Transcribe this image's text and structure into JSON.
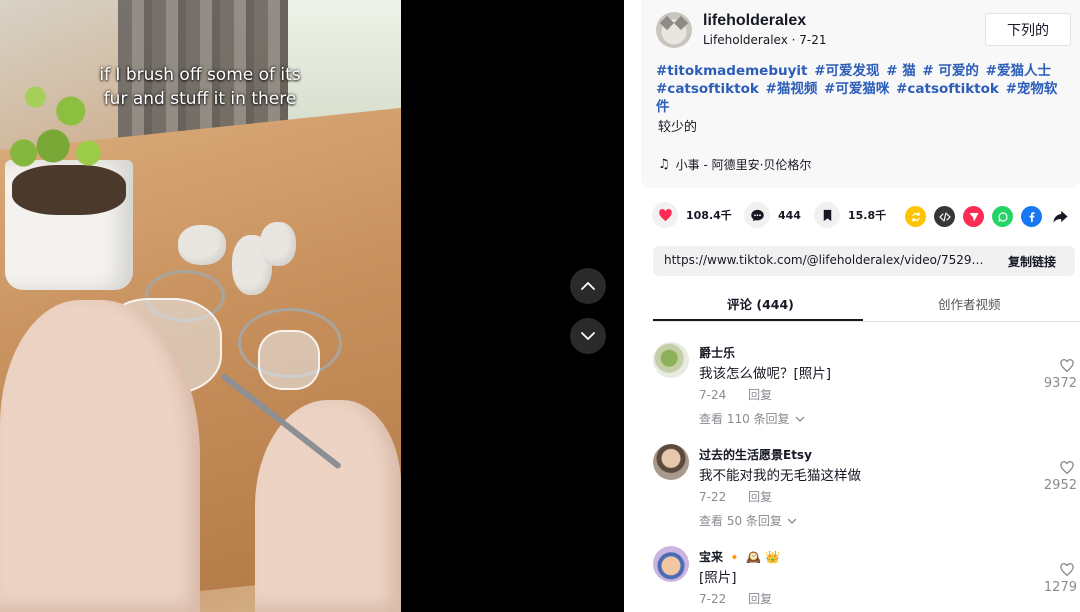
{
  "video": {
    "caption_line1": "if I brush off some of its",
    "caption_line2": "fur and stuff it in there"
  },
  "author": {
    "name": "lifeholderalex",
    "handle_date": "Lifeholderalex · 7-21",
    "follow_label": "下列的"
  },
  "description": {
    "hashtags": [
      "#titokmademebuyit",
      "#可爱发现",
      "# 猫",
      "# 可爱的",
      "#爱猫人士",
      "#catsoftiktok",
      "#猫视频",
      "#可爱猫咪",
      "#catsoftiktok",
      "#宠物软件"
    ],
    "text": "较少的",
    "music": "小事 - 阿德里安·贝伦格尔"
  },
  "actions": {
    "likes": "108.4千",
    "comments": "444",
    "saves": "15.8千",
    "share_icons": [
      "repost-icon",
      "embed-icon",
      "send-icon",
      "whatsapp-icon",
      "facebook-icon",
      "share-arrow-icon"
    ],
    "colors": {
      "like": "#fe2c55",
      "repost": "#ffc300",
      "embed": "#363636",
      "send": "#fe2c55",
      "whatsapp": "#25d366",
      "facebook": "#1877f2"
    }
  },
  "link": {
    "url": "https://www.tiktok.com/@lifeholderalex/video/7529453...",
    "copy_label": "复制链接"
  },
  "tabs": {
    "comments": "评论 (444)",
    "creator_videos": "创作者视频"
  },
  "comments": [
    {
      "user": "爵士乐",
      "text": "我该怎么做呢？[照片]",
      "date": "7-24",
      "reply": "回复",
      "view_replies": "查看 110 条回复",
      "likes": "9372"
    },
    {
      "user": "过去的生活愿景Etsy",
      "text": "我不能对我的无毛猫这样做",
      "date": "7-22",
      "reply": "回复",
      "view_replies": "查看 50 条回复",
      "likes": "2952"
    },
    {
      "user": "宝来 🔸 🕰️ 👑",
      "text": "[照片]",
      "date": "7-22",
      "reply": "回复",
      "likes": "1279"
    }
  ]
}
